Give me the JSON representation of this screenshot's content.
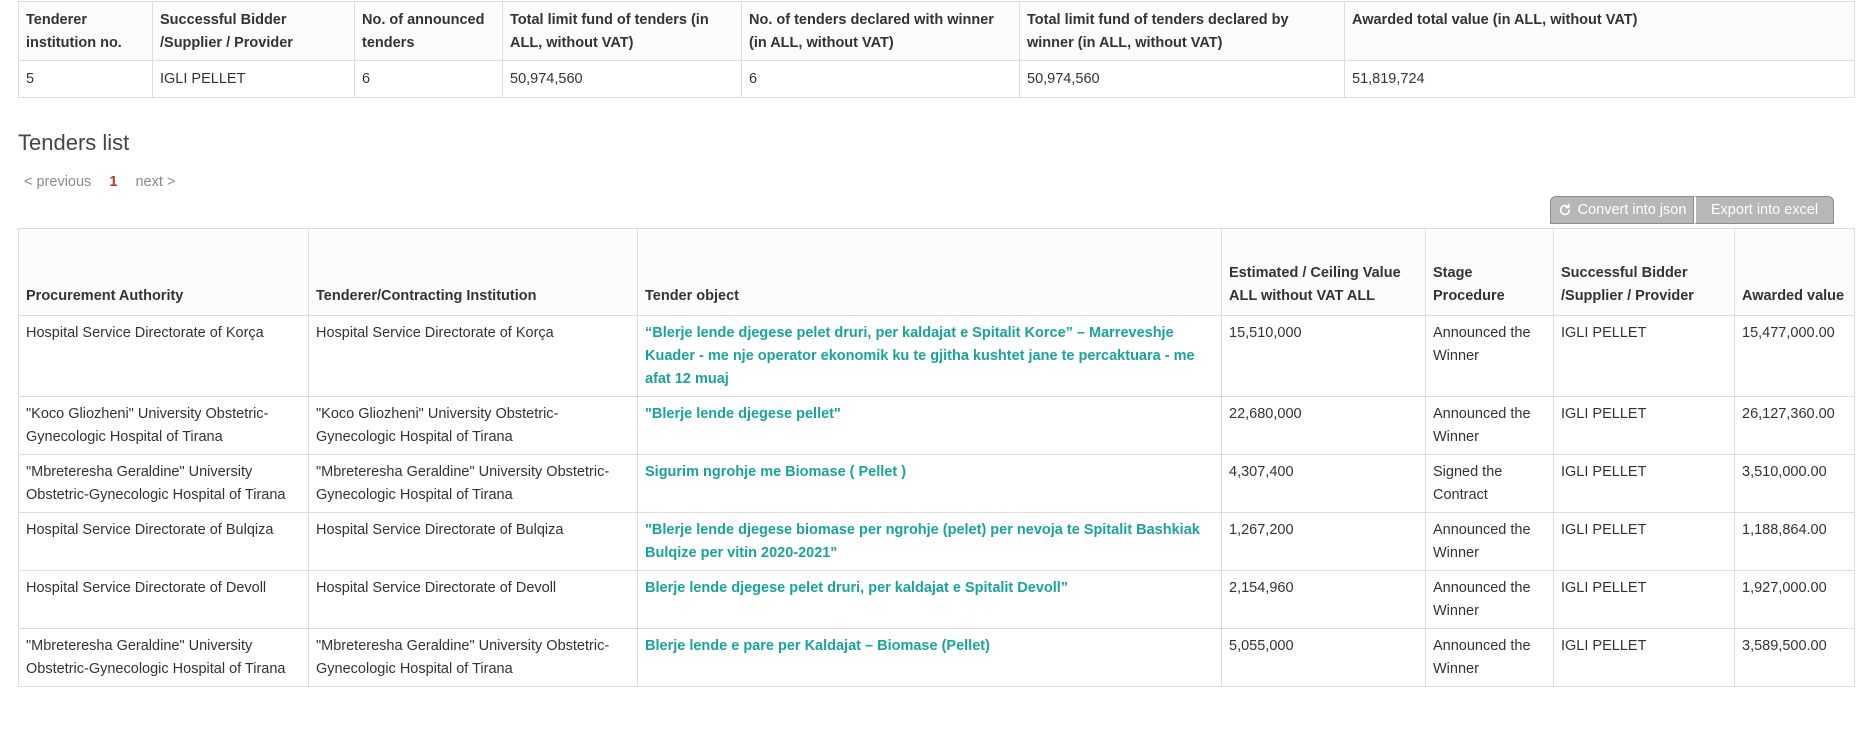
{
  "summary": {
    "headers": [
      "Tenderer institution no.",
      "Successful Bidder /Supplier / Provider",
      "No. of announced tenders",
      "Total limit fund of tenders (in ALL, without VAT)",
      "No. of tenders declared with winner (in ALL, without VAT)",
      "Total limit fund of tenders declared by winner (in ALL, without VAT)",
      "Awarded total value (in ALL, without VAT)"
    ],
    "row": [
      "5",
      "IGLI PELLET",
      "6",
      "50,974,560",
      "6",
      "50,974,560",
      "51,819,724"
    ]
  },
  "tenders_list": {
    "title": "Tenders list",
    "pagination": {
      "previous": "< previous",
      "current": "1",
      "next": "next >"
    },
    "toolbar": {
      "convert_json": "Convert into json",
      "export_excel": "Export into excel"
    },
    "headers": [
      "Procurement Authority",
      "Tenderer/Contracting Institution",
      "Tender object",
      "Estimated / Ceiling Value ALL without VAT ALL",
      "Stage Procedure",
      "Successful Bidder /Supplier / Provider",
      "Awarded value"
    ],
    "rows": [
      {
        "authority": "Hospital Service Directorate of Korça",
        "institution": "Hospital Service Directorate of Korça",
        "object": "“Blerje lende djegese pelet druri, per kaldajat e Spitalit Korce” – Marreveshje Kuader - me nje operator ekonomik ku te gjitha kushtet jane te percaktuara - me afat 12 muaj",
        "estimated": "15,510,000",
        "stage": "Announced the Winner",
        "bidder": "IGLI PELLET",
        "awarded": "15,477,000.00"
      },
      {
        "authority": "\"Koco Gliozheni\" University Obstetric-Gynecologic Hospital of Tirana",
        "institution": "\"Koco Gliozheni\" University Obstetric-Gynecologic Hospital of Tirana",
        "object": "\"Blerje lende djegese pellet\"",
        "estimated": "22,680,000",
        "stage": "Announced the Winner",
        "bidder": "IGLI PELLET",
        "awarded": "26,127,360.00"
      },
      {
        "authority": "\"Mbreteresha Geraldine\" University Obstetric-Gynecologic Hospital of Tirana",
        "institution": "\"Mbreteresha Geraldine\" University Obstetric-Gynecologic Hospital of Tirana",
        "object": "Sigurim ngrohje me Biomase ( Pellet )",
        "estimated": "4,307,400",
        "stage": "Signed the Contract",
        "bidder": "IGLI PELLET",
        "awarded": "3,510,000.00"
      },
      {
        "authority": "Hospital Service Directorate of Bulqiza",
        "institution": "Hospital Service Directorate of Bulqiza",
        "object": "\"Blerje lende djegese biomase per ngrohje (pelet) per nevoja te Spitalit Bashkiak Bulqize per vitin 2020-2021\"",
        "estimated": "1,267,200",
        "stage": "Announced the Winner",
        "bidder": "IGLI PELLET",
        "awarded": "1,188,864.00"
      },
      {
        "authority": "Hospital Service Directorate of Devoll",
        "institution": "Hospital Service Directorate of Devoll",
        "object": "Blerje lende djegese pelet druri, per kaldajat e Spitalit Devoll”",
        "estimated": "2,154,960",
        "stage": "Announced the Winner",
        "bidder": "IGLI PELLET",
        "awarded": "1,927,000.00"
      },
      {
        "authority": "\"Mbreteresha Geraldine\" University Obstetric-Gynecologic Hospital of Tirana",
        "institution": "\"Mbreteresha Geraldine\" University Obstetric-Gynecologic Hospital of Tirana",
        "object": "Blerje lende e pare per Kaldajat – Biomase (Pellet)",
        "estimated": "5,055,000",
        "stage": "Announced the Winner",
        "bidder": "IGLI PELLET",
        "awarded": "3,589,500.00"
      }
    ]
  },
  "colors": {
    "link": "#1aa39a",
    "current_page": "#b3362b",
    "toolbar_button": "#b7b7b7",
    "border": "#dddddd"
  },
  "icons": {
    "convert_json": "refresh-icon"
  }
}
